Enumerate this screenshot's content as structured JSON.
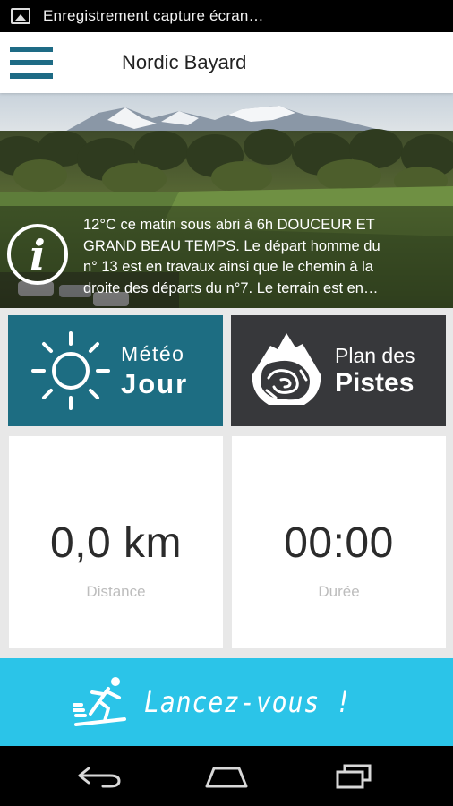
{
  "statusbar": {
    "text": "Enregistrement capture écran…",
    "icon": "image-icon"
  },
  "appbar": {
    "title": "Nordic Bayard",
    "menu_icon": "hamburger-menu-icon",
    "accent": "#1e6b85"
  },
  "hero": {
    "info_lines": [
      "12°C ce matin sous abri à 6h DOUCEUR ET",
      "GRAND BEAU TEMPS. Le départ homme du",
      "n° 13 est en travaux ainsi que le chemin à la",
      "droite des départs du n°7. Le terrain est en…"
    ],
    "info_icon": "info-icon"
  },
  "tiles": {
    "meteo": {
      "line1": "Météo",
      "line2": "Jour",
      "icon": "sun-icon",
      "color": "#1d6d82"
    },
    "plan": {
      "line1": "Plan des",
      "line2": "Pistes",
      "icon": "mountain-map-icon",
      "color": "#37383b"
    }
  },
  "stats": {
    "distance": {
      "value": "0,0 km",
      "label": "Distance"
    },
    "duration": {
      "value": "00:00",
      "label": "Durée"
    }
  },
  "cta": {
    "label": "Lancez-vous !",
    "icon": "skier-icon",
    "color": "#2bc4e8"
  },
  "navbar": {
    "back_icon": "back-icon",
    "home_icon": "home-icon",
    "recents_icon": "recents-icon"
  }
}
